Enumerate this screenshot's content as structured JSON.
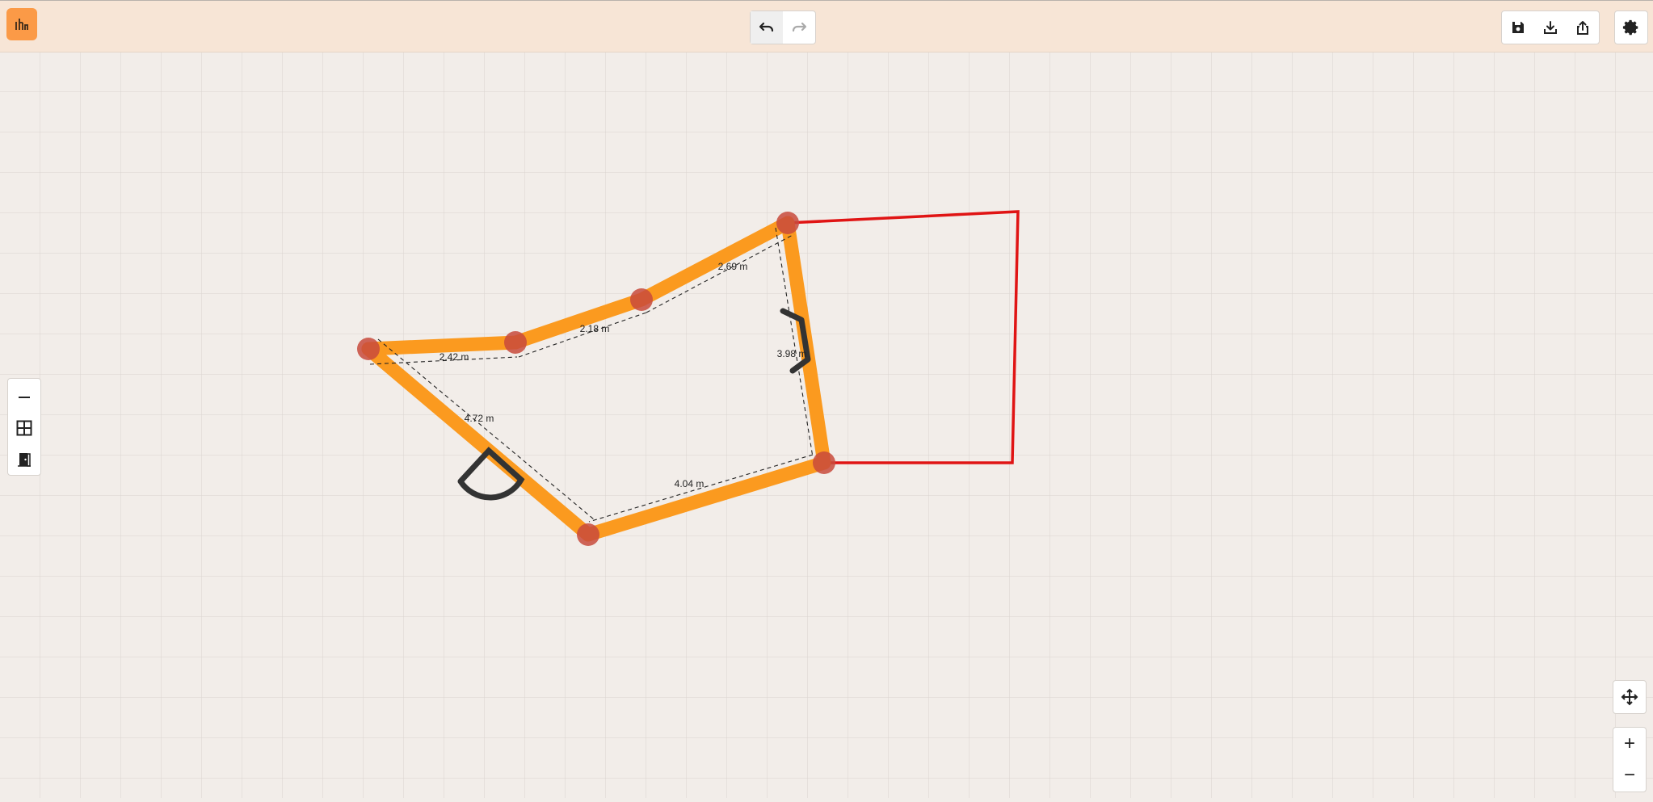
{
  "app": {
    "logo_icon": "floorplan-logo-icon",
    "accent": "#fb9a47"
  },
  "toolbar": {
    "undo_icon": "undo-icon",
    "redo_icon": "redo-icon",
    "save_icon": "save-icon",
    "download_icon": "download-icon",
    "share_icon": "share-icon",
    "settings_icon": "gear-icon"
  },
  "tools": [
    {
      "name": "wall-tool",
      "icon": "wall-line-icon"
    },
    {
      "name": "window-tool",
      "icon": "window-grid-icon"
    },
    {
      "name": "door-tool",
      "icon": "door-icon"
    }
  ],
  "plan": {
    "wall_color": "#fb9a1f",
    "vertex_color": "#c84a3c",
    "outline_color": "#e01414",
    "dimensions": [
      {
        "label": "2.42 m"
      },
      {
        "label": "2.18 m"
      },
      {
        "label": "2.69 m"
      },
      {
        "label": "3.98 m"
      },
      {
        "label": "4.04 m"
      },
      {
        "label": "4.72 m"
      }
    ]
  },
  "view_controls": {
    "pan_icon": "move-arrows-icon",
    "zoom_in": "+",
    "zoom_out": "−"
  }
}
